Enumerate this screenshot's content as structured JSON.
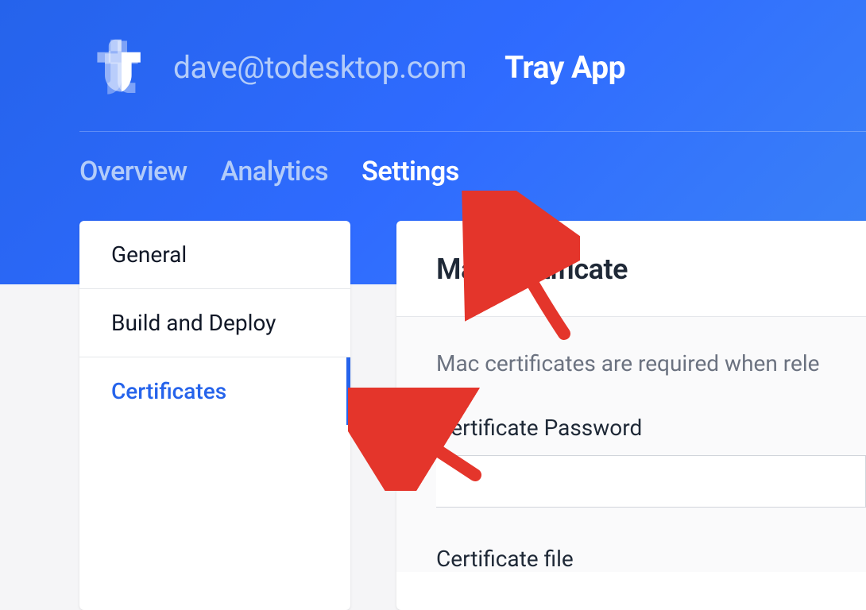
{
  "header": {
    "email": "dave@todesktop.com",
    "app_name": "Tray App"
  },
  "nav": {
    "tabs": [
      {
        "label": "Overview",
        "active": false
      },
      {
        "label": "Analytics",
        "active": false
      },
      {
        "label": "Settings",
        "active": true
      }
    ]
  },
  "sidebar": {
    "items": [
      {
        "label": "General",
        "active": false
      },
      {
        "label": "Build and Deploy",
        "active": false
      },
      {
        "label": "Certificates",
        "active": true
      }
    ]
  },
  "panel": {
    "title": "Mac Certificate",
    "description": "Mac certificates are required when rele",
    "fields": [
      {
        "label": "Certificate Password"
      },
      {
        "label": "Certificate file"
      }
    ]
  }
}
